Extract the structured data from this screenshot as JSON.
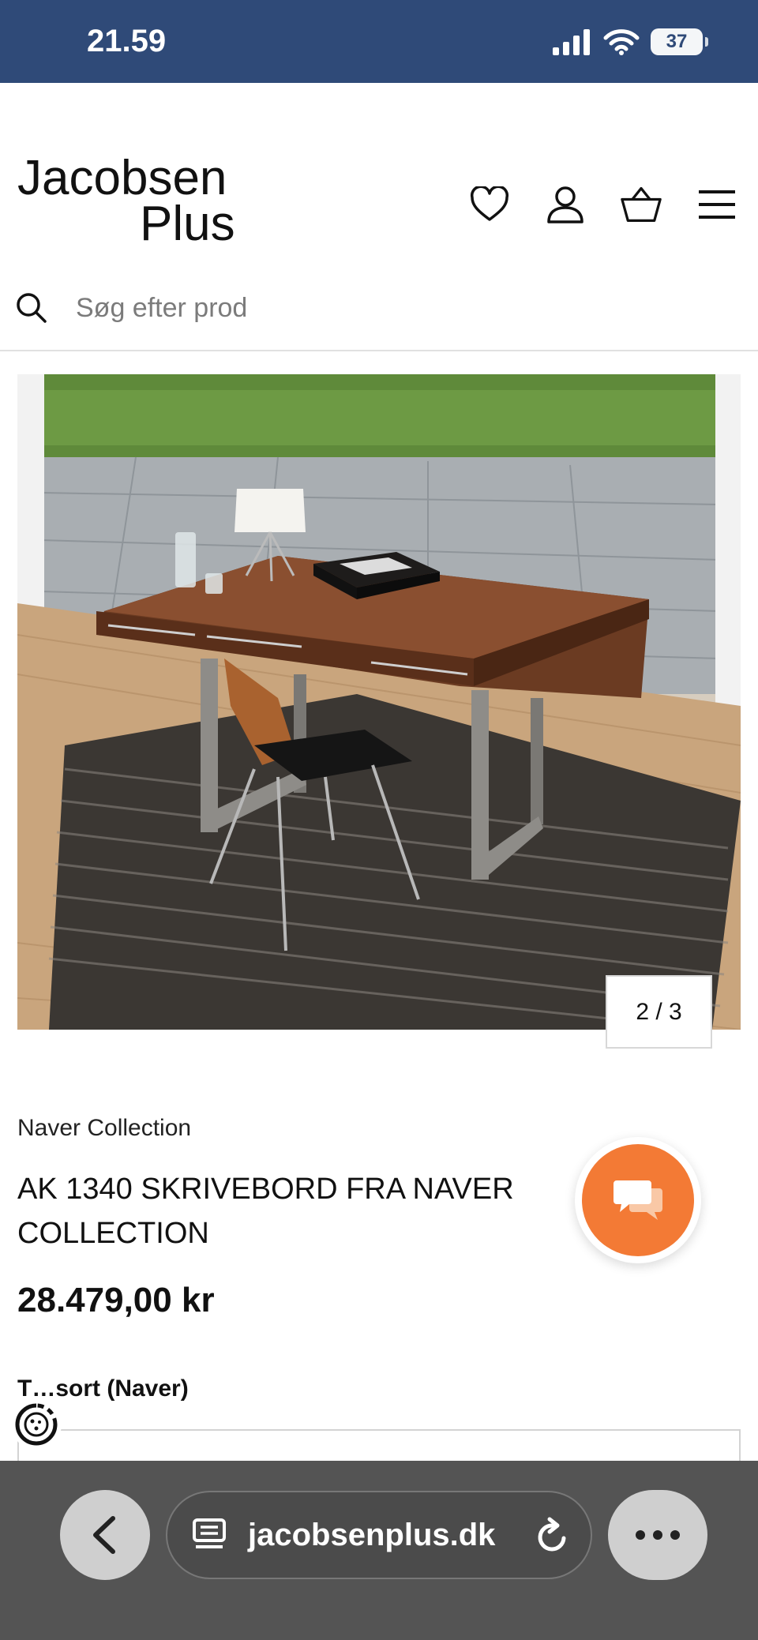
{
  "status_bar": {
    "time": "21.59",
    "battery": "37"
  },
  "header": {
    "logo_line1": "Jacobsen",
    "logo_line2": "Plus",
    "search_placeholder": "Søg efter prod",
    "icons": [
      "heart-icon",
      "user-icon",
      "basket-icon",
      "menu-icon"
    ]
  },
  "gallery": {
    "counter": "2 / 3"
  },
  "product": {
    "brand": "Naver Collection",
    "title": "AK 1340 SKRIVEBORD FRA NAVER COLLECTION",
    "price": "28.479,00 kr",
    "variant_label": "T…sort (Naver)"
  },
  "browser": {
    "url": "jacobsenplus.dk"
  },
  "colors": {
    "status_bar": "#2f4a78",
    "chat_accent": "#f37a35",
    "browser_bar": "#545454"
  }
}
